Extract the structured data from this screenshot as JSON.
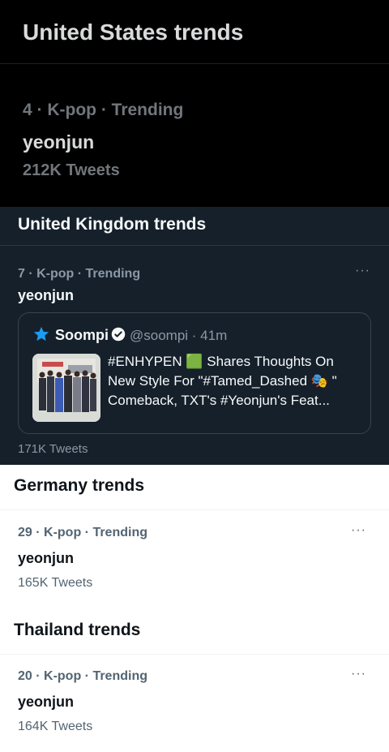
{
  "us": {
    "title": "United States trends",
    "meta": "4 · K-pop · Trending",
    "topic": "yeonjun",
    "count": "212K Tweets"
  },
  "uk": {
    "title": "United Kingdom trends",
    "meta": "7 · K-pop · Trending",
    "topic": "yeonjun",
    "more": "···",
    "count": "171K Tweets",
    "quoted": {
      "author": "Soompi",
      "handle": "@soompi · 41m",
      "line1": "#ENHYPEN 🟩 Shares Thoughts On",
      "line2": "New Style For \"#Tamed_Dashed 🎭 \"",
      "line3": "Comeback, TXT's #Yeonjun's Feat..."
    }
  },
  "germany": {
    "title": "Germany trends",
    "meta": "29 · K-pop · Trending",
    "topic": "yeonjun",
    "more": "···",
    "count": "165K Tweets"
  },
  "thailand": {
    "title": "Thailand trends",
    "meta": "20 · K-pop · Trending",
    "topic": "yeonjun",
    "more": "···",
    "count": "164K Tweets"
  },
  "colors": {
    "us_bg": "#000000",
    "uk_bg": "#15202b",
    "light_bg": "#ffffff",
    "verified": "#1d9bf0"
  },
  "icons": [
    "star-icon",
    "verified-badge-icon",
    "more-icon"
  ]
}
